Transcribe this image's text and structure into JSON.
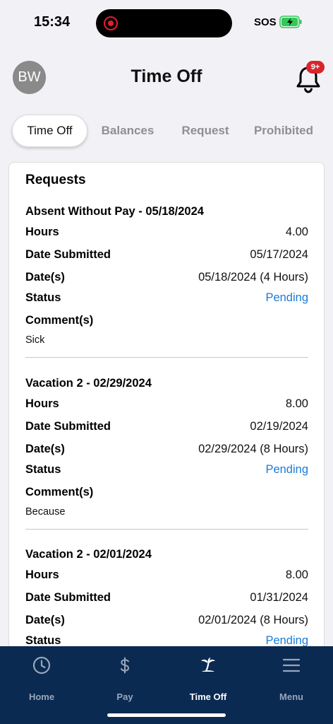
{
  "status_bar": {
    "time": "15:34",
    "carrier": "SOS",
    "battery_icon": "battery-charging-icon",
    "battery_color": "#34c759"
  },
  "header": {
    "avatar_initials": "BW",
    "title": "Time Off",
    "notification_badge": "9+",
    "badge_color": "#d9262c"
  },
  "tabs": [
    {
      "label": "Time Off",
      "active": true
    },
    {
      "label": "Balances",
      "active": false
    },
    {
      "label": "Request",
      "active": false
    },
    {
      "label": "Prohibited",
      "active": false
    }
  ],
  "card": {
    "title": "Requests",
    "labels": {
      "hours": "Hours",
      "date_submitted": "Date Submitted",
      "dates": "Date(s)",
      "status": "Status",
      "comments": "Comment(s)"
    },
    "requests": [
      {
        "title": "Absent Without Pay - 05/18/2024",
        "hours": "4.00",
        "date_submitted": "05/17/2024",
        "dates": "05/18/2024 (4 Hours)",
        "status": "Pending",
        "comment": "Sick"
      },
      {
        "title": "Vacation 2 - 02/29/2024",
        "hours": "8.00",
        "date_submitted": "02/19/2024",
        "dates": "02/29/2024 (8 Hours)",
        "status": "Pending",
        "comment": "Because"
      },
      {
        "title": "Vacation 2 - 02/01/2024",
        "hours": "8.00",
        "date_submitted": "01/31/2024",
        "dates": "02/01/2024 (8 Hours)",
        "status": "Pending"
      }
    ]
  },
  "tabbar": {
    "items": [
      {
        "label": "Home",
        "icon": "clock-icon",
        "active": false
      },
      {
        "label": "Pay",
        "icon": "dollar-icon",
        "active": false
      },
      {
        "label": "Time Off",
        "icon": "palm-tree-icon",
        "active": true
      },
      {
        "label": "Menu",
        "icon": "hamburger-menu-icon",
        "active": false
      }
    ],
    "background": "#0a2a52"
  },
  "colors": {
    "accent_link": "#1a7bd8"
  }
}
